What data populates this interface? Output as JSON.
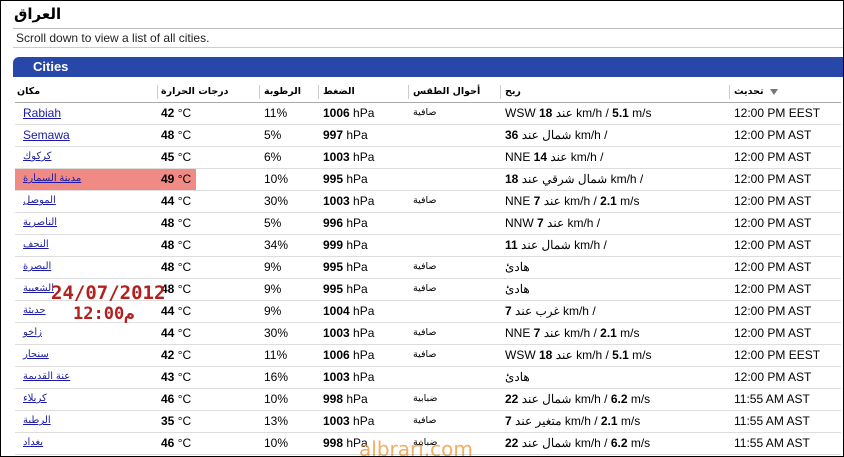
{
  "page": {
    "title": "العراق",
    "subtitle": "Scroll down to view a list of all cities.",
    "section_title": "Cities"
  },
  "table": {
    "headers": {
      "city": "مكان",
      "temperature": "درجات الحرارة",
      "humidity": "الرطوبة",
      "pressure": "الضغط",
      "conditions": "أحوال الطقس",
      "wind": "ريح",
      "updated": "تحديث"
    },
    "rows": [
      {
        "city": "Rabiah",
        "temp": "42",
        "humidity": "11%",
        "pressure": "1006",
        "conditions": "صافية",
        "wind_pre": "WSW ",
        "wind_num": "18",
        "wind_mid": " عند km/h / ",
        "wind_num2": "5.1",
        "wind_post": " m/s",
        "updated": "12:00 PM EEST"
      },
      {
        "city": "Semawa",
        "temp": "48",
        "humidity": "5%",
        "pressure": "997",
        "conditions": "",
        "wind_pre": "",
        "wind_num": "36",
        "wind_mid": " شمال عند km/h /",
        "wind_num2": "",
        "wind_post": "",
        "updated": "12:00 PM AST"
      },
      {
        "city": "كركوك",
        "temp": "45",
        "humidity": "6%",
        "pressure": "1003",
        "conditions": "",
        "wind_pre": "NNE ",
        "wind_num": "14",
        "wind_mid": " عند km/h /",
        "wind_num2": "",
        "wind_post": "",
        "updated": "12:00 PM AST"
      },
      {
        "city": "مدينة السمارة",
        "temp": "49",
        "humidity": "10%",
        "pressure": "995",
        "conditions": "",
        "wind_pre": "",
        "wind_num": "18",
        "wind_mid": " شمال شرقي عند km/h /",
        "wind_num2": "",
        "wind_post": "",
        "updated": "12:00 PM AST"
      },
      {
        "city": "الموصل",
        "temp": "44",
        "humidity": "30%",
        "pressure": "1003",
        "conditions": "صافية",
        "wind_pre": "NNE ",
        "wind_num": "7",
        "wind_mid": " عند km/h / ",
        "wind_num2": "2.1",
        "wind_post": " m/s",
        "updated": "12:00 PM AST"
      },
      {
        "city": "الناصرية",
        "temp": "48",
        "humidity": "5%",
        "pressure": "996",
        "conditions": "",
        "wind_pre": "NNW ",
        "wind_num": "7",
        "wind_mid": " عند km/h /",
        "wind_num2": "",
        "wind_post": "",
        "updated": "12:00 PM AST"
      },
      {
        "city": "النجف",
        "temp": "48",
        "humidity": "34%",
        "pressure": "999",
        "conditions": "",
        "wind_pre": "",
        "wind_num": "11",
        "wind_mid": " شمال عند km/h /",
        "wind_num2": "",
        "wind_post": "",
        "updated": "12:00 PM AST"
      },
      {
        "city": "البصرة",
        "temp": "48",
        "humidity": "9%",
        "pressure": "995",
        "conditions": "صافية",
        "wind_pre": "",
        "wind_num": "",
        "wind_mid": "هادئ",
        "wind_num2": "",
        "wind_post": "",
        "updated": "12:00 PM AST"
      },
      {
        "city": "الشعيبة",
        "temp": "48",
        "humidity": "9%",
        "pressure": "995",
        "conditions": "صافية",
        "wind_pre": "",
        "wind_num": "",
        "wind_mid": "هادئ",
        "wind_num2": "",
        "wind_post": "",
        "updated": "12:00 PM AST"
      },
      {
        "city": "حديثة",
        "temp": "44",
        "humidity": "9%",
        "pressure": "1004",
        "conditions": "",
        "wind_pre": "",
        "wind_num": "7",
        "wind_mid": " غرب عند km/h /",
        "wind_num2": "",
        "wind_post": "",
        "updated": "12:00 PM AST"
      },
      {
        "city": "زاخو",
        "temp": "44",
        "humidity": "30%",
        "pressure": "1003",
        "conditions": "صافية",
        "wind_pre": "NNE ",
        "wind_num": "7",
        "wind_mid": " عند km/h / ",
        "wind_num2": "2.1",
        "wind_post": " m/s",
        "updated": "12:00 PM AST"
      },
      {
        "city": "سنجار",
        "temp": "42",
        "humidity": "11%",
        "pressure": "1006",
        "conditions": "صافية",
        "wind_pre": "WSW ",
        "wind_num": "18",
        "wind_mid": " عند km/h / ",
        "wind_num2": "5.1",
        "wind_post": " m/s",
        "updated": "12:00 PM EEST"
      },
      {
        "city": "عنة القديمة",
        "temp": "43",
        "humidity": "16%",
        "pressure": "1003",
        "conditions": "",
        "wind_pre": "",
        "wind_num": "",
        "wind_mid": "هادئ",
        "wind_num2": "",
        "wind_post": "",
        "updated": "12:00 PM AST"
      },
      {
        "city": "كربلاء",
        "temp": "46",
        "humidity": "10%",
        "pressure": "998",
        "conditions": "ضبابية",
        "wind_pre": "",
        "wind_num": "22",
        "wind_mid": " شمال عند km/h / ",
        "wind_num2": "6.2",
        "wind_post": " m/s",
        "updated": "11:55 AM AST"
      },
      {
        "city": "الرطبة",
        "temp": "35",
        "humidity": "13%",
        "pressure": "1003",
        "conditions": "صافية",
        "wind_pre": "",
        "wind_num": "7",
        "wind_mid": " متغير عند km/h / ",
        "wind_num2": "2.1",
        "wind_post": " m/s",
        "updated": "11:55 AM AST"
      },
      {
        "city": "بغداد",
        "temp": "46",
        "humidity": "10%",
        "pressure": "998",
        "conditions": "ضبابية",
        "wind_pre": "",
        "wind_num": "22",
        "wind_mid": " شمال عند km/h / ",
        "wind_num2": "6.2",
        "wind_post": " m/s",
        "updated": "11:55 AM AST"
      }
    ],
    "units": {
      "temp": " °C",
      "pressure": " hPa"
    }
  },
  "overlay": {
    "date": "24/07/2012",
    "time": "12:00م"
  },
  "watermark": "albrari.com",
  "colors": {
    "header_bar": "#2748a8",
    "highlight": "#f08a84",
    "link": "#1a1aa6",
    "overlay": "#b3201e"
  }
}
